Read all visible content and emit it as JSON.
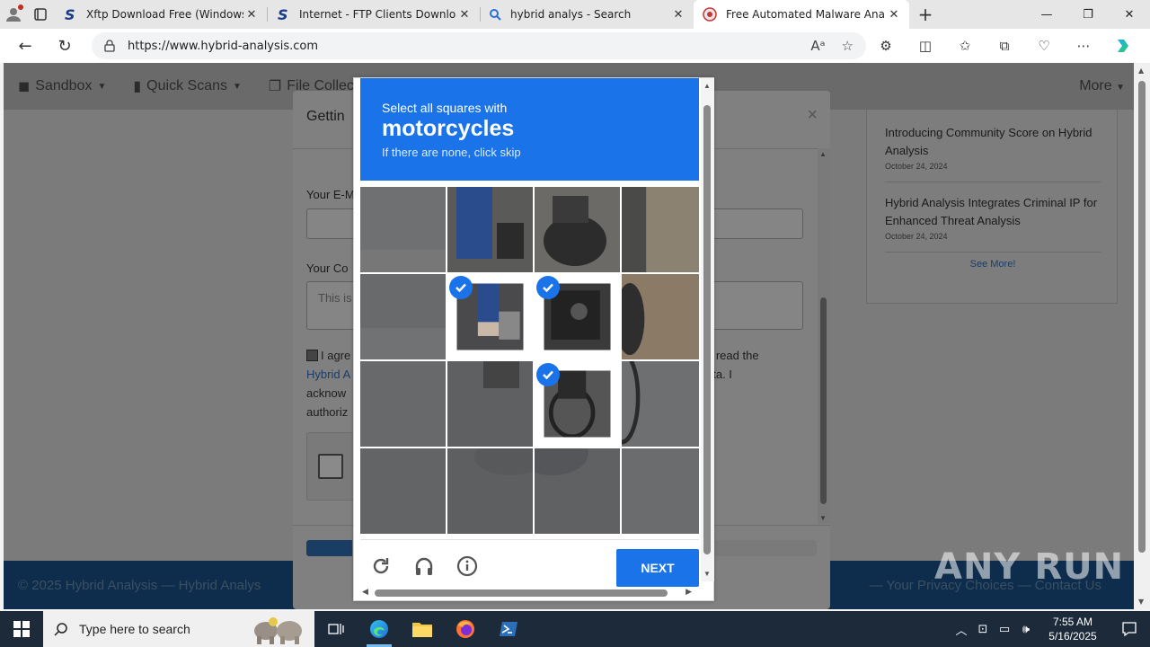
{
  "browser": {
    "tabs": [
      {
        "title": "Xftp Download Free (Windows) -",
        "icon": "softpedia-s-icon"
      },
      {
        "title": "Internet - FTP Clients Downloads",
        "icon": "softpedia-s-icon"
      },
      {
        "title": "hybrid analys - Search",
        "icon": "search-icon"
      },
      {
        "title": "Free Automated Malware Analysi",
        "icon": "hybrid-analysis-icon",
        "active": true
      }
    ],
    "url": "https://www.hybrid-analysis.com"
  },
  "site": {
    "nav": [
      "Sandbox",
      "Quick Scans",
      "File Collec"
    ],
    "nav_more": "More",
    "news": [
      {
        "title": "Introducing Community Score on Hybrid Analysis",
        "date": "October 24, 2024"
      },
      {
        "title": "Hybrid Analysis Integrates Criminal IP for Enhanced Threat Analysis",
        "date": "October 24, 2024"
      }
    ],
    "see_more": "See More!",
    "footer_copy": "© 2025 Hybrid Analysis — Hybrid Analys",
    "footer_links": "— Your Privacy Choices — Contact Us"
  },
  "modal": {
    "title": "Gettin",
    "email_label": "Your E-M",
    "comment_label": "Your Co",
    "comment_placeholder": "This is",
    "agree_text_1": "I agre",
    "agree_link": "Hybrid A",
    "agree_text_3": "acknow",
    "agree_text_4": "authoriz",
    "agree_right_1": "e read the",
    "agree_right_2": "ata. I",
    "progress": 0.09
  },
  "captcha": {
    "instruction": "Select all squares with",
    "target": "motorcycles",
    "hint": "If there are none, click skip",
    "selected_tiles": [
      5,
      6,
      10
    ],
    "next_label": "NEXT",
    "icons": [
      "reload-icon",
      "audio-icon",
      "info-icon"
    ]
  },
  "watermark": "ANY RUN",
  "taskbar": {
    "search_placeholder": "Type here to search",
    "time": "7:55 AM",
    "date": "5/16/2025"
  }
}
